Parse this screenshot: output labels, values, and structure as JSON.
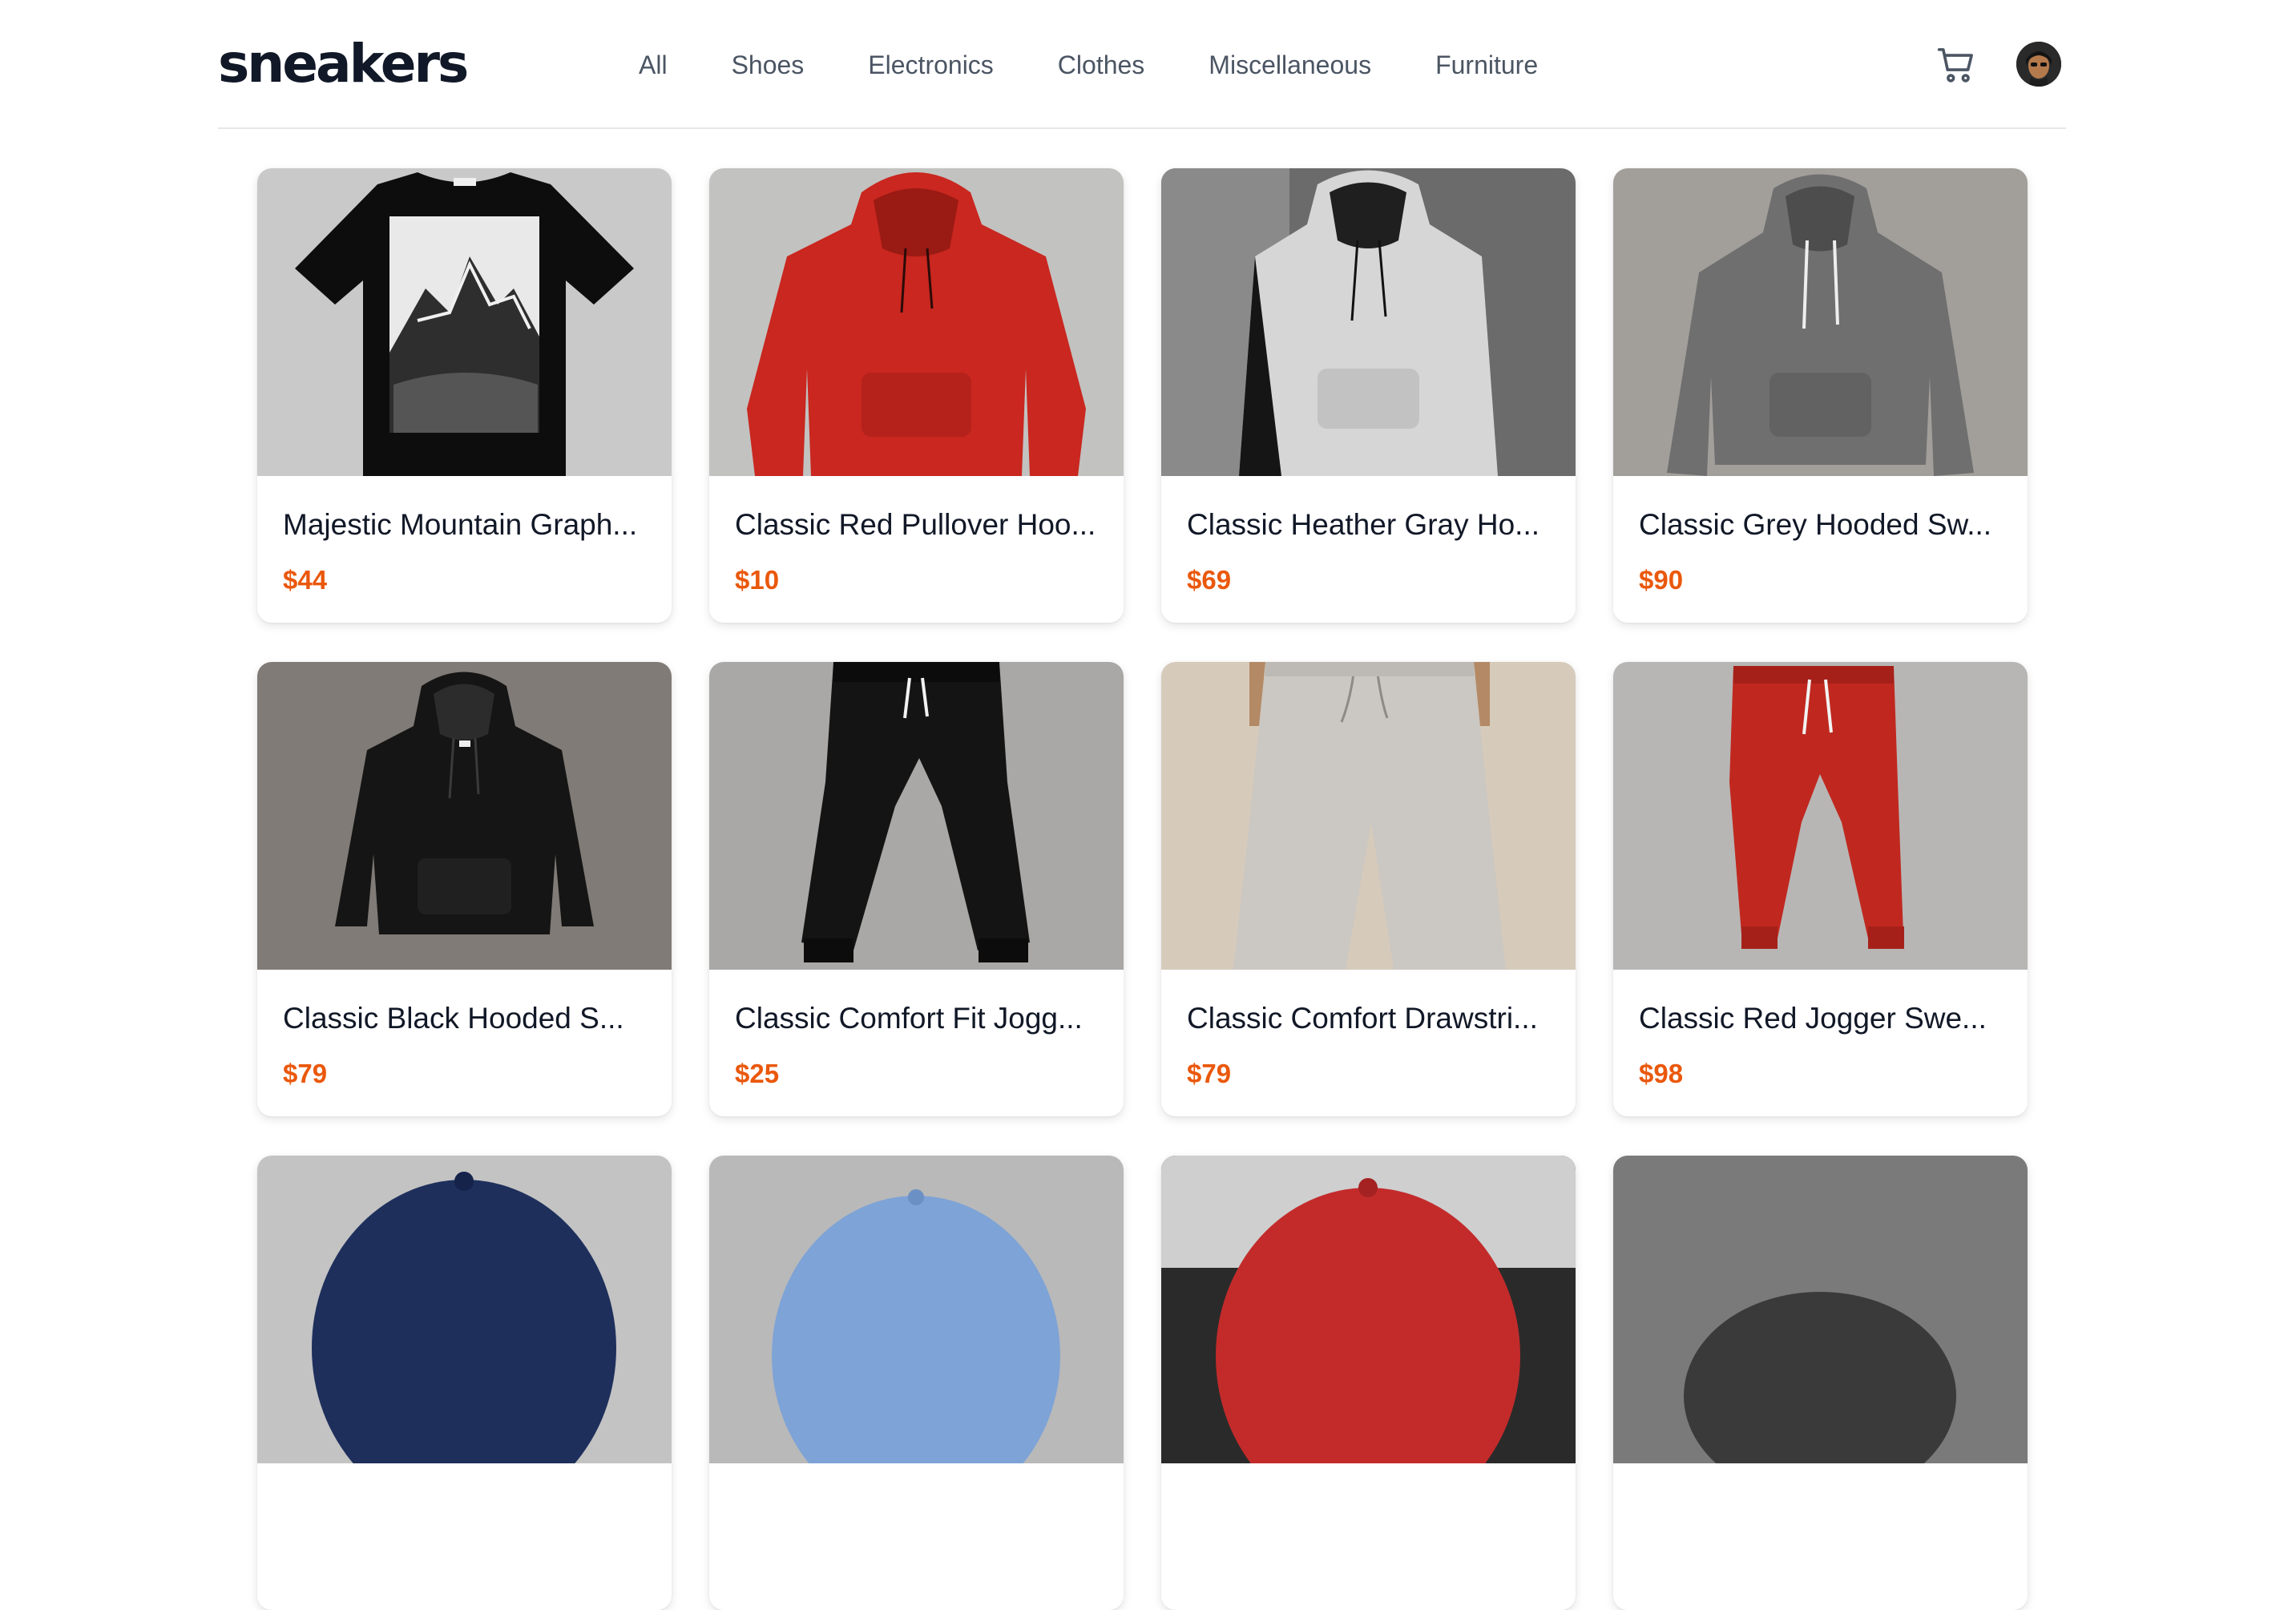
{
  "header": {
    "logo": "sneakers",
    "nav": [
      "All",
      "Shoes",
      "Electronics",
      "Clothes",
      "Miscellaneous",
      "Furniture"
    ],
    "cart_icon": "shopping-cart-icon",
    "avatar_icon": "user-avatar"
  },
  "products": [
    {
      "title": "Majestic Mountain Graph...",
      "price": "$44"
    },
    {
      "title": "Classic Red Pullover Hoo...",
      "price": "$10"
    },
    {
      "title": "Classic Heather Gray Ho...",
      "price": "$69"
    },
    {
      "title": "Classic Grey Hooded Sw...",
      "price": "$90"
    },
    {
      "title": "Classic Black Hooded S...",
      "price": "$79"
    },
    {
      "title": "Classic Comfort Fit Jogg...",
      "price": "$25"
    },
    {
      "title": "Classic Comfort Drawstri...",
      "price": "$79"
    },
    {
      "title": "Classic Red Jogger Swe...",
      "price": "$98"
    }
  ],
  "colors": {
    "accent_price": "#ea580c",
    "text": "#111827",
    "nav": "#4b5563"
  }
}
